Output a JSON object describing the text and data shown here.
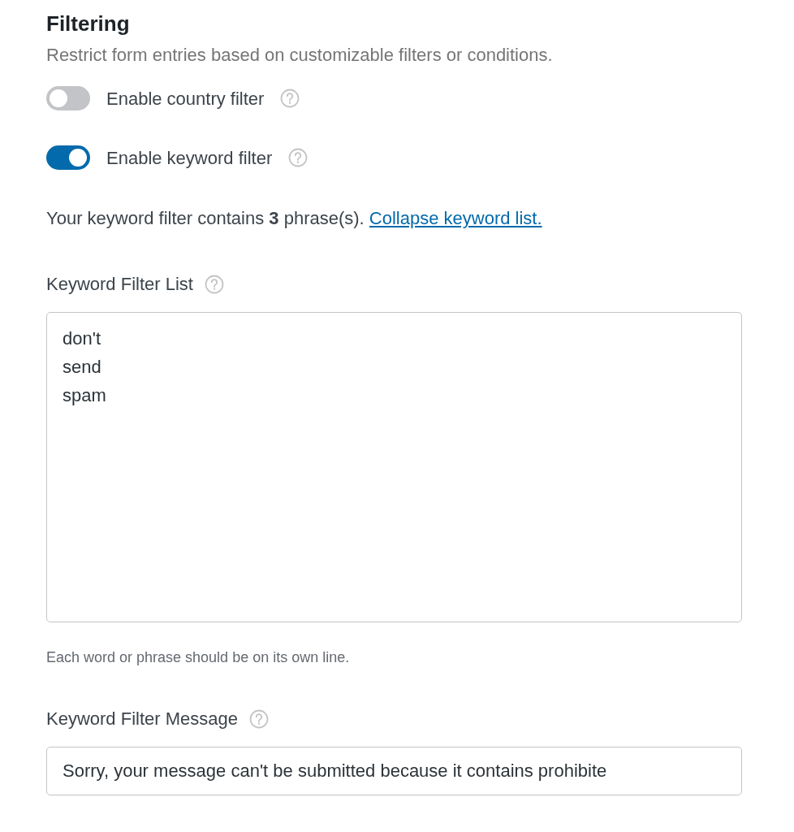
{
  "section": {
    "title": "Filtering",
    "description": "Restrict form entries based on customizable filters or conditions."
  },
  "toggles": [
    {
      "label": "Enable country filter",
      "on": false
    },
    {
      "label": "Enable keyword filter",
      "on": true
    }
  ],
  "summary": {
    "text": "Your keyword filter contains **3** phrase(s). ",
    "link": "Collapse keyword list."
  },
  "keyword_list": {
    "label": "Keyword Filter List",
    "lines": [
      "don't",
      "send",
      "spam"
    ],
    "hint": "Each word or phrase should be on its own line."
  },
  "keyword_message": {
    "label": "Keyword Filter Message",
    "value": "Sorry, your message can't be submitted because it contains prohibite"
  }
}
